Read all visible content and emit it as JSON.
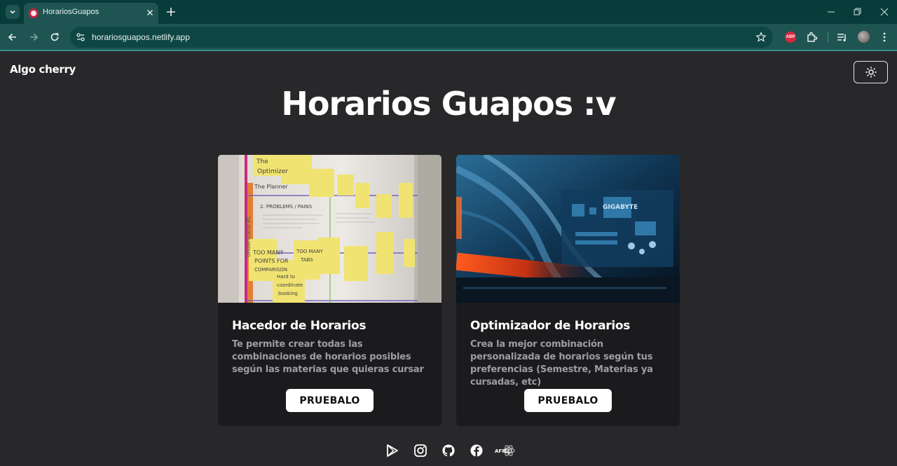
{
  "browser": {
    "tab_title": "HorariosGuapos",
    "url": "horariosguapos.netlify.app",
    "abp_label": "ABP"
  },
  "header": {
    "brand": "Algo cherry",
    "theme_toggle_icon": "sun-icon"
  },
  "main": {
    "title": "Horarios Guapos :v",
    "cards": [
      {
        "title": "Hacedor de Horarios",
        "description": "Te permite crear todas las combinaciones de horarios posibles según las materias que quieras cursar",
        "button": "PRUEBALO",
        "image": "sticky-notes-whiteboard-photo",
        "image_text": [
          "The",
          "Optimizer",
          "The Planner",
          "2. PROBLEMS / PAINS",
          "TOO MANY POINTS FOR COMPARISON",
          "Hard to coordinate booking",
          "TOO MANY TABS",
          "Understand RC"
        ]
      },
      {
        "title": "Optimizador de Horarios",
        "description": "Crea la mejor combinación personalizada de horarios según tus preferencias (Semestre, Materias ya cursadas, etc)",
        "button": "PRUEBALO",
        "image": "computer-motherboard-photo",
        "image_text": [
          "GIGABYTE"
        ]
      }
    ]
  },
  "footer": {
    "icons": [
      "google-play-icon",
      "instagram-icon",
      "github-icon",
      "facebook-icon",
      "afiee-logo-icon"
    ],
    "logo_text": "AFIEE"
  },
  "colors": {
    "page_bg": "#28282b",
    "card_bg": "#1b1b1d",
    "browser_tab_bg": "#083c3a",
    "toolbar_bg": "#1e5553"
  }
}
